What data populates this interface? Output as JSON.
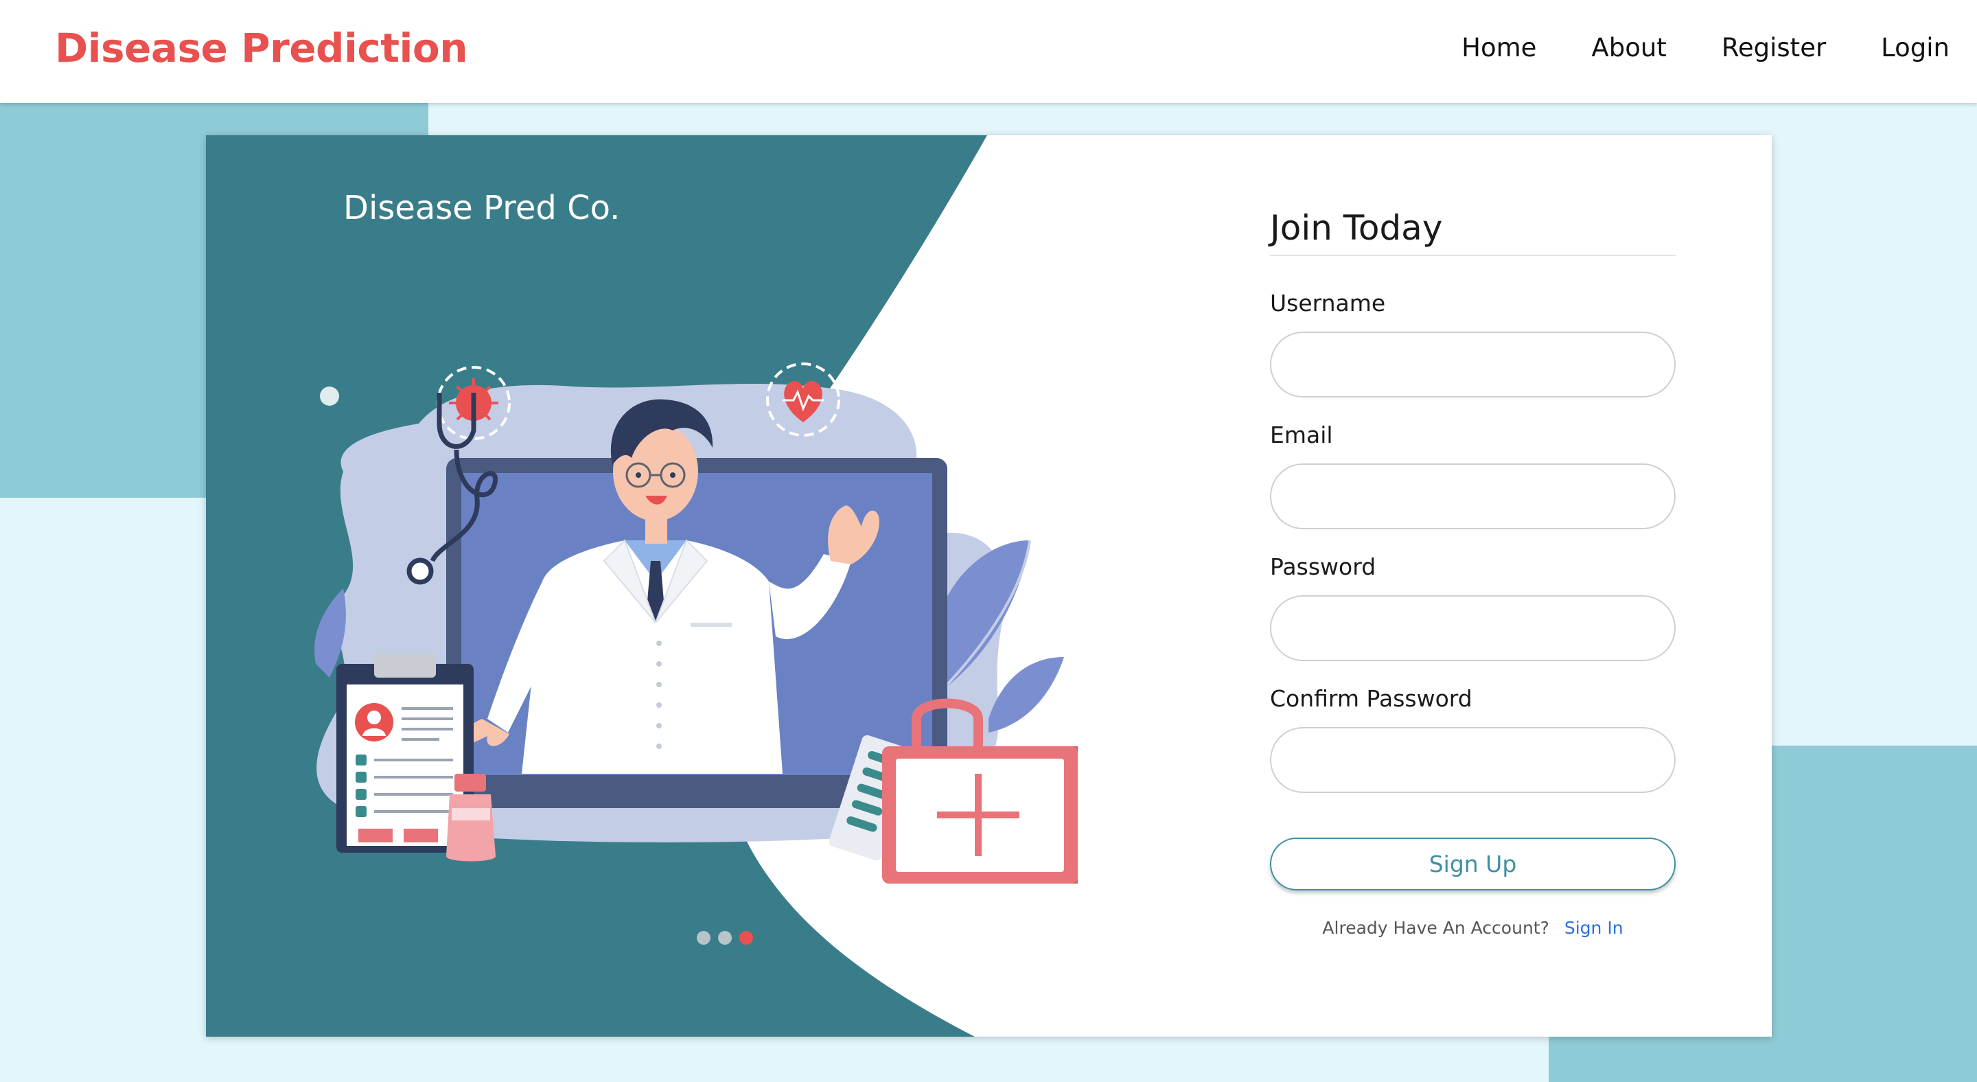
{
  "navbar": {
    "brand": "Disease Prediction",
    "links": [
      "Home",
      "About",
      "Register",
      "Login"
    ]
  },
  "hero": {
    "company": "Disease Pred Co.",
    "carousel_active_index": 2,
    "carousel_count": 3
  },
  "form": {
    "title": "Join Today",
    "fields": {
      "username": {
        "label": "Username",
        "value": ""
      },
      "email": {
        "label": "Email",
        "value": ""
      },
      "password": {
        "label": "Password",
        "value": ""
      },
      "confirm_password": {
        "label": "Confirm Password",
        "value": ""
      }
    },
    "submit_label": "Sign Up",
    "account_prompt": "Already Have An Account?",
    "signin_label": "Sign In"
  },
  "colors": {
    "brand": "#e8514f",
    "panel": "#3a7d8a",
    "accent": "#3f8fa3",
    "link": "#2b6fe0",
    "background": "#e3f6fb",
    "background_block": "#8ecbd6"
  },
  "icons": [
    "virus-icon",
    "heart-rate-icon",
    "stethoscope-icon",
    "clipboard-icon",
    "first-aid-kit-icon",
    "pill-pack-icon",
    "medicine-bottle-icon",
    "plant-leaf-icon"
  ]
}
